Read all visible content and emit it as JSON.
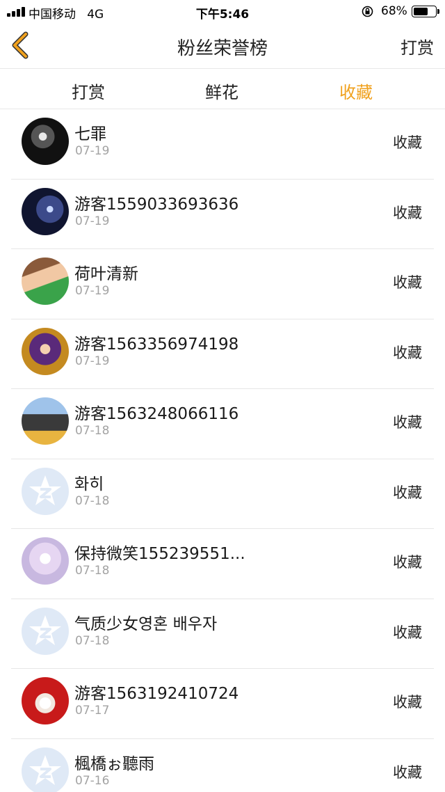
{
  "status_bar": {
    "carrier": "中国移动",
    "network": "4G",
    "time": "下午5:46",
    "battery_percent": "68%",
    "battery_level": 0.68
  },
  "nav": {
    "title": "粉丝荣誉榜",
    "right_button": "打赏",
    "back_icon": "chevron-left-icon",
    "back_color": "#f0a11e"
  },
  "tabs": [
    {
      "label": "打赏",
      "active": false
    },
    {
      "label": "鲜花",
      "active": false
    },
    {
      "label": "收藏",
      "active": true
    }
  ],
  "accent_color": "#f0a11e",
  "fans": [
    {
      "name": "七罪",
      "date": "07-19",
      "action": "收藏",
      "avatar": "photo"
    },
    {
      "name": "游客1559033693636",
      "date": "07-19",
      "action": "收藏",
      "avatar": "photo"
    },
    {
      "name": "荷叶清新",
      "date": "07-19",
      "action": "收藏",
      "avatar": "photo"
    },
    {
      "name": "游客1563356974198",
      "date": "07-19",
      "action": "收藏",
      "avatar": "photo"
    },
    {
      "name": "游客1563248066116",
      "date": "07-18",
      "action": "收藏",
      "avatar": "photo"
    },
    {
      "name": "화히",
      "date": "07-18",
      "action": "收藏",
      "avatar": "qq-default-icon"
    },
    {
      "name": "保持微笑155239551...",
      "date": "07-18",
      "action": "收藏",
      "avatar": "photo"
    },
    {
      "name": "气质少女영혼 배우자",
      "date": "07-18",
      "action": "收藏",
      "avatar": "qq-default-icon"
    },
    {
      "name": "游客1563192410724",
      "date": "07-17",
      "action": "收藏",
      "avatar": "photo"
    },
    {
      "name": "楓橋ぉ聽雨",
      "date": "07-16",
      "action": "收藏",
      "avatar": "qq-default-icon"
    }
  ]
}
